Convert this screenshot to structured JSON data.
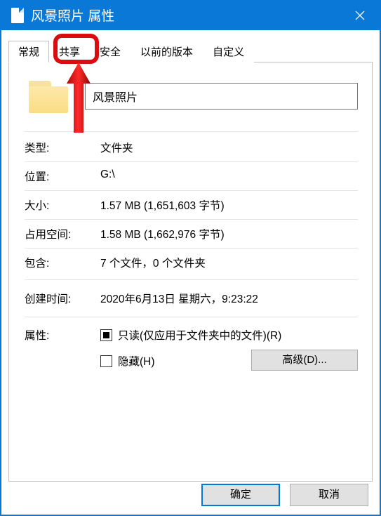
{
  "titlebar": {
    "icon": "document-icon",
    "title": "风景照片 属性"
  },
  "tabs": [
    "常规",
    "共享",
    "安全",
    "以前的版本",
    "自定义"
  ],
  "activeTab": 0,
  "highlightedTab": 1,
  "folder": {
    "name": "风景照片"
  },
  "rows": {
    "type_label": "类型:",
    "type_value": "文件夹",
    "location_label": "位置:",
    "location_value": "G:\\",
    "size_label": "大小:",
    "size_value": "1.57 MB (1,651,603 字节)",
    "sizeondisk_label": "占用空间:",
    "sizeondisk_value": "1.58 MB (1,662,976 字节)",
    "contains_label": "包含:",
    "contains_value": "7 个文件，0 个文件夹",
    "created_label": "创建时间:",
    "created_value": "2020年6月13日 星期六，9:23:22"
  },
  "attributes": {
    "label": "属性:",
    "readonly_label": "只读(仅应用于文件夹中的文件)(R)",
    "readonly_state": "indeterminate",
    "hidden_label": "隐藏(H)",
    "hidden_state": "unchecked",
    "advanced_btn": "高级(D)..."
  },
  "buttons": {
    "ok": "确定",
    "cancel": "取消"
  }
}
